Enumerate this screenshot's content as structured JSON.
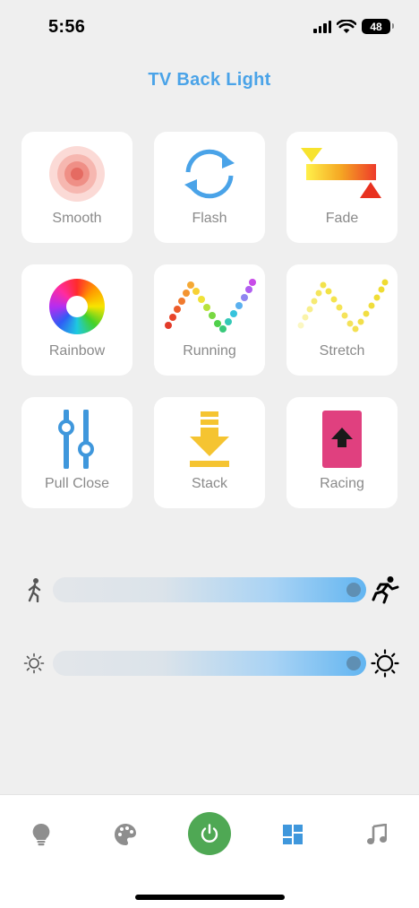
{
  "status_bar": {
    "time": "5:56",
    "battery": "48"
  },
  "header": {
    "title": "TV Back Light"
  },
  "effects": [
    {
      "label": "Smooth",
      "icon": "smooth-circles-icon"
    },
    {
      "label": "Flash",
      "icon": "flash-cycle-arrows-icon"
    },
    {
      "label": "Fade",
      "icon": "fade-gradient-icon"
    },
    {
      "label": "Rainbow",
      "icon": "rainbow-color-wheel-icon"
    },
    {
      "label": "Running",
      "icon": "running-dots-icon"
    },
    {
      "label": "Stretch",
      "icon": "stretch-dots-icon"
    },
    {
      "label": "Pull Close",
      "icon": "pull-close-sliders-icon"
    },
    {
      "label": "Stack",
      "icon": "stack-download-icon"
    },
    {
      "label": "Racing",
      "icon": "racing-card-icon"
    }
  ],
  "sliders": {
    "speed": {
      "value": 1.0,
      "min_icon": "walking-person-icon",
      "max_icon": "running-person-icon"
    },
    "brightness": {
      "value": 1.0,
      "min_icon": "sun-dim-icon",
      "max_icon": "sun-bright-icon"
    }
  },
  "tab_bar": {
    "items": [
      "bulb-icon",
      "palette-icon",
      "power-icon",
      "effects-grid-icon",
      "music-note-icon"
    ],
    "active": "effects-grid-icon"
  },
  "colors": {
    "accent": "#4aa3e8",
    "power_green": "#4fa854",
    "background": "#efefef"
  }
}
